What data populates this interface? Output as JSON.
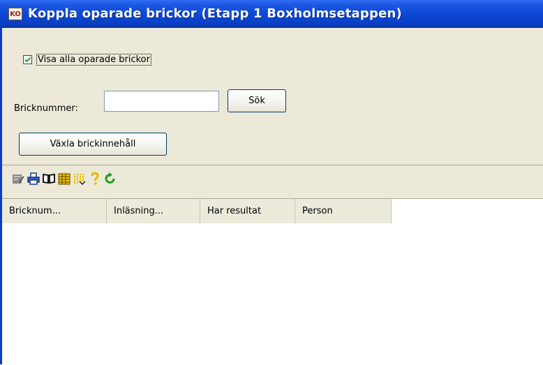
{
  "window": {
    "title": "Koppla oparade brickor (Etapp 1 Boxholmsetappen)",
    "icon_text": "KO",
    "title_bar_color": "#0a3fc4"
  },
  "filter": {
    "show_all_label": "Visa alla oparade brickor",
    "show_all_checked": true
  },
  "search": {
    "label": "Bricknummer:",
    "input_value": "",
    "button_label": "Sök"
  },
  "actions": {
    "toggle_label": "Växla brickinnehåll"
  },
  "toolbar": {
    "icons": [
      "edit-icon",
      "print-icon",
      "book-icon",
      "table-grid-icon",
      "columns-icon",
      "help-icon",
      "refresh-icon"
    ]
  },
  "table": {
    "columns": [
      "Bricknum...",
      "Inläsning...",
      "Har resultat",
      "Person"
    ],
    "rows": []
  }
}
